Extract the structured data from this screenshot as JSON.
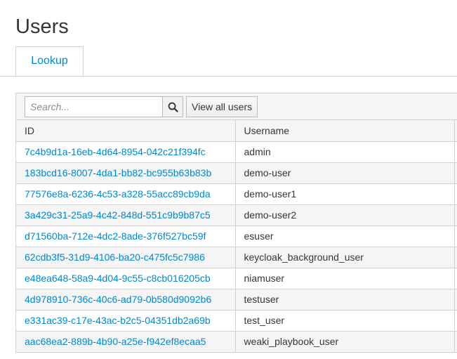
{
  "page": {
    "title": "Users"
  },
  "tabs": [
    {
      "label": "Lookup"
    }
  ],
  "toolbar": {
    "search_placeholder": "Search...",
    "search_icon": "search-icon",
    "view_all_label": "View all users"
  },
  "table": {
    "columns": [
      "ID",
      "Username"
    ],
    "rows": [
      {
        "id": "7c4b9d1a-16eb-4d64-8954-042c21f394fc",
        "username": "admin"
      },
      {
        "id": "183bcd16-8007-4da1-bb82-bc955b63b83b",
        "username": "demo-user"
      },
      {
        "id": "77576e8a-6236-4c53-a328-55acc89cb9da",
        "username": "demo-user1"
      },
      {
        "id": "3a429c31-25a9-4c42-848d-551c9b9b87c5",
        "username": "demo-user2"
      },
      {
        "id": "d71560ba-712e-4dc2-8ade-376f527bc59f",
        "username": "esuser"
      },
      {
        "id": "62cdb3f5-31d9-4106-ba20-c475fc5c7986",
        "username": "keycloak_background_user"
      },
      {
        "id": "e48ea648-58a9-4d04-9c55-c8cb016205cb",
        "username": "niamuser"
      },
      {
        "id": "4d978910-736c-40c6-ad79-0b580d9092b6",
        "username": "testuser"
      },
      {
        "id": "e331ac39-c17e-43ac-b2c5-04351db2a69b",
        "username": "test_user"
      },
      {
        "id": "aac68ea2-889b-4b90-a25e-f942ef8ecaa5",
        "username": "weaki_playbook_user"
      }
    ]
  },
  "colors": {
    "link": "#0088ce",
    "text": "#363636",
    "border": "#d1d1d1",
    "stripe": "#f5f5f5"
  }
}
